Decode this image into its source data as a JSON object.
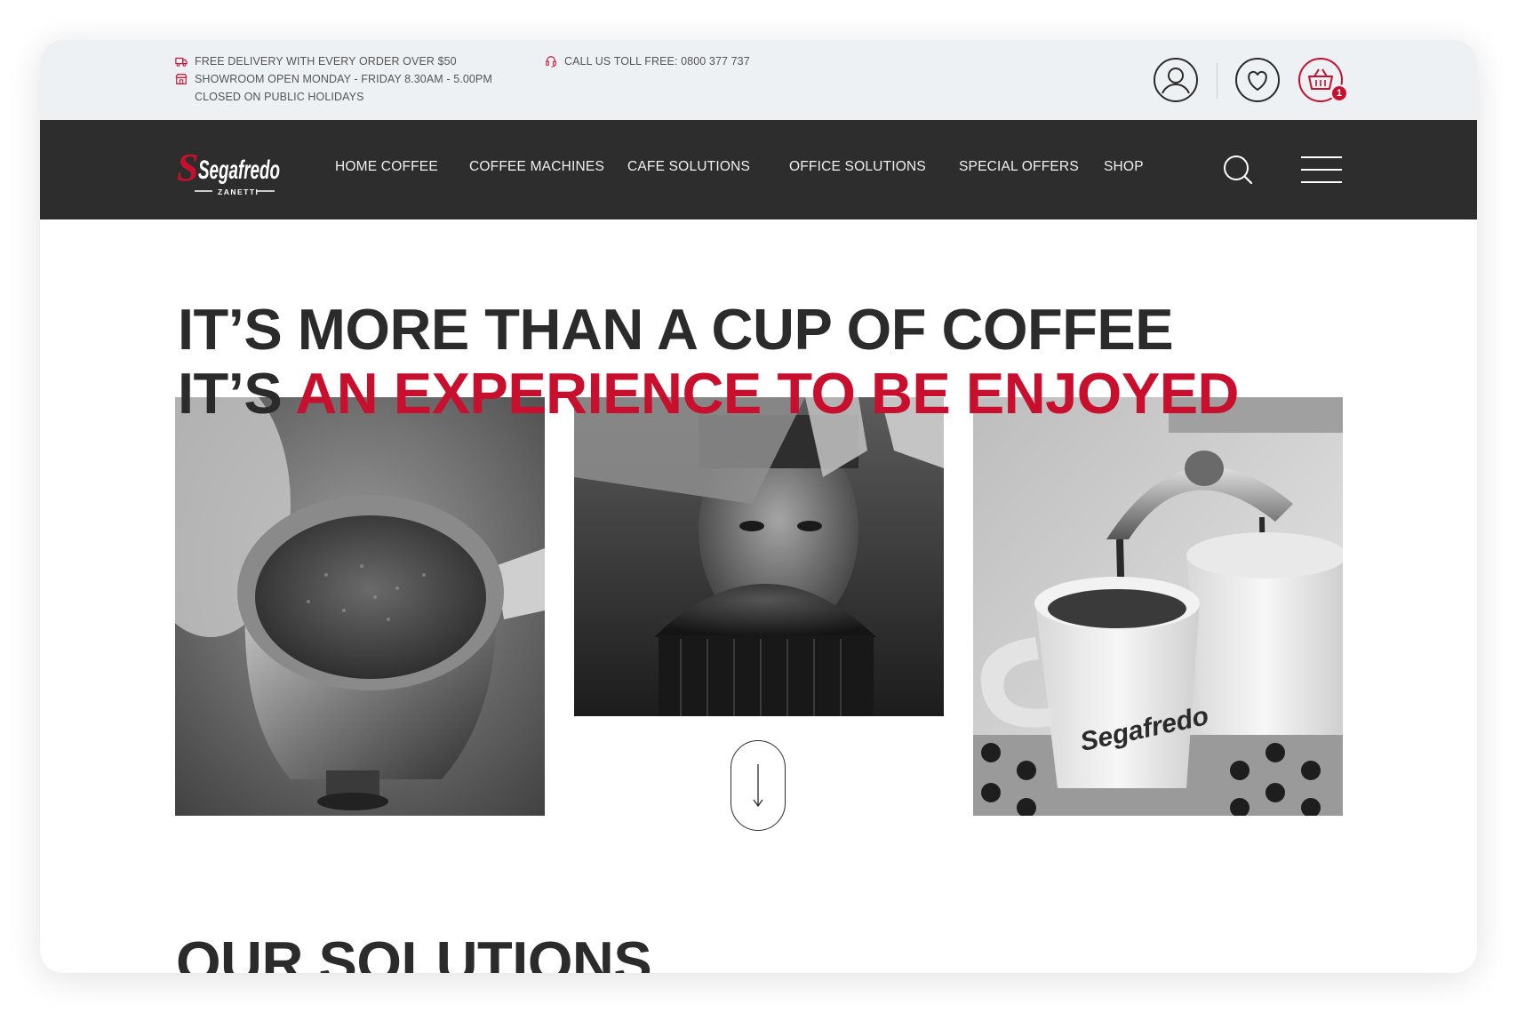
{
  "topbar": {
    "delivery": "FREE DELIVERY WITH EVERY ORDER OVER $50",
    "showroom": "SHOWROOM OPEN MONDAY - FRIDAY 8.30AM - 5.00PM",
    "holidays": "CLOSED ON PUBLIC HOLIDAYS",
    "phone": "CALL US TOLL FREE: 0800 377 737",
    "cart_count": "1"
  },
  "brand": {
    "name": "Segafredo",
    "sub": "ZANETTI",
    "accent_color": "#c8102e",
    "nav_bg": "#2d2d2d"
  },
  "nav": {
    "items": [
      "HOME COFFEE",
      "COFFEE MACHINES",
      "CAFE SOLUTIONS",
      "OFFICE SOLUTIONS",
      "SPECIAL OFFERS",
      "SHOP"
    ]
  },
  "hero": {
    "line1": "IT’S MORE THAN A CUP OF COFFEE",
    "line2_prefix": "IT’S ",
    "line2_accent": "AN EXPERIENCE TO BE ENJOYED",
    "cup_logo": "Segafredo"
  },
  "solutions": {
    "title": "OUR SOLUTIONS"
  },
  "icons": {
    "delivery": "truck-icon",
    "showroom": "store-icon",
    "phone": "headset-icon",
    "user": "user-icon",
    "wishlist": "heart-icon",
    "cart": "basket-icon",
    "search": "search-icon",
    "menu": "hamburger-icon",
    "scroll": "arrow-down-icon"
  }
}
